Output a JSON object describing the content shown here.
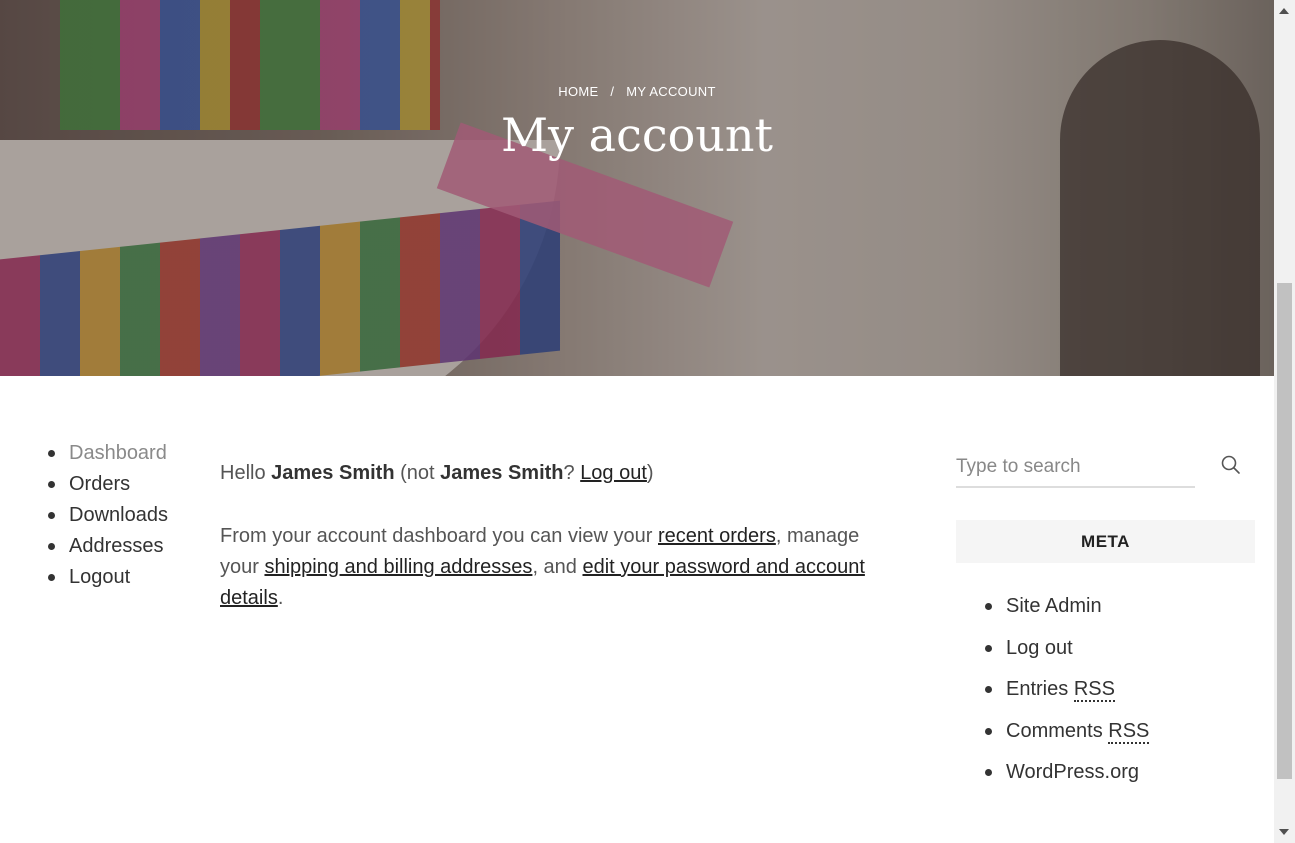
{
  "hero": {
    "breadcrumb": {
      "home": "HOME",
      "separator": "/",
      "current": "MY ACCOUNT"
    },
    "title": "My account"
  },
  "account_nav": {
    "items": [
      {
        "label": "Dashboard",
        "active": true
      },
      {
        "label": "Orders",
        "active": false
      },
      {
        "label": "Downloads",
        "active": false
      },
      {
        "label": "Addresses",
        "active": false
      },
      {
        "label": "Logout",
        "active": false
      }
    ]
  },
  "content": {
    "hello_prefix": "Hello ",
    "user_name": "James Smith",
    "not_prefix": " (not ",
    "not_name": "James Smith",
    "question": "? ",
    "logout_link": "Log out",
    "close_paren": ")",
    "dashboard_text_1": "From your account dashboard you can view your ",
    "recent_orders_link": "recent orders",
    "dashboard_text_2": ", manage your ",
    "addresses_link": "shipping and billing addresses",
    "dashboard_text_3": ", and ",
    "account_details_link": "edit your password and account details",
    "dashboard_text_4": "."
  },
  "sidebar": {
    "search": {
      "placeholder": "Type to search",
      "icon": "search-icon"
    },
    "meta": {
      "title": "META",
      "items": [
        {
          "text": "Site Admin",
          "abbr": ""
        },
        {
          "text": "Log out",
          "abbr": ""
        },
        {
          "text": "Entries ",
          "abbr": "RSS"
        },
        {
          "text": "Comments ",
          "abbr": "RSS"
        },
        {
          "text": "WordPress.org",
          "abbr": ""
        }
      ]
    }
  },
  "colors": {
    "accent_text": "#333333",
    "active_nav": "#8a8a8a",
    "meta_bg": "#f5f5f5"
  }
}
